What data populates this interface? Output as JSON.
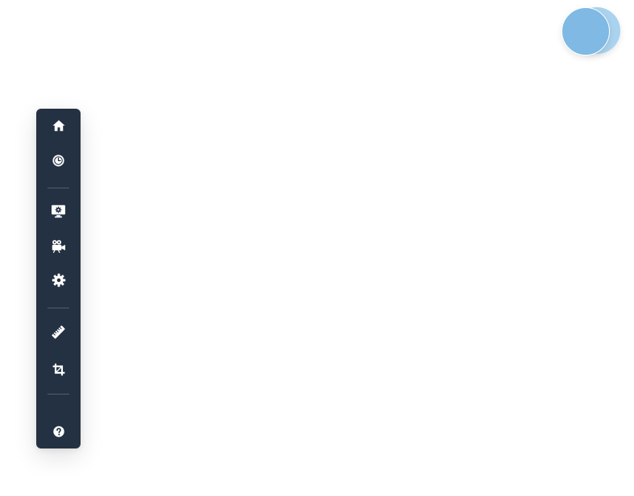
{
  "window": {
    "background": "#ffffff"
  },
  "logo": {
    "primary_color": "#7fb9e4",
    "secondary_color": "#a9d3ef"
  },
  "toolbar": {
    "background": "#243142",
    "icon_color": "#ffffff",
    "groups": [
      {
        "tools": [
          {
            "icon": "home-icon"
          },
          {
            "icon": "clock-icon"
          }
        ]
      },
      {
        "tools": [
          {
            "icon": "monitor-settings-icon"
          },
          {
            "icon": "video-camera-icon"
          },
          {
            "icon": "gear-icon"
          }
        ]
      },
      {
        "tools": [
          {
            "icon": "ruler-icon"
          },
          {
            "icon": "crop-icon"
          }
        ]
      },
      {
        "tools": [
          {
            "icon": "help-icon"
          }
        ]
      }
    ]
  }
}
